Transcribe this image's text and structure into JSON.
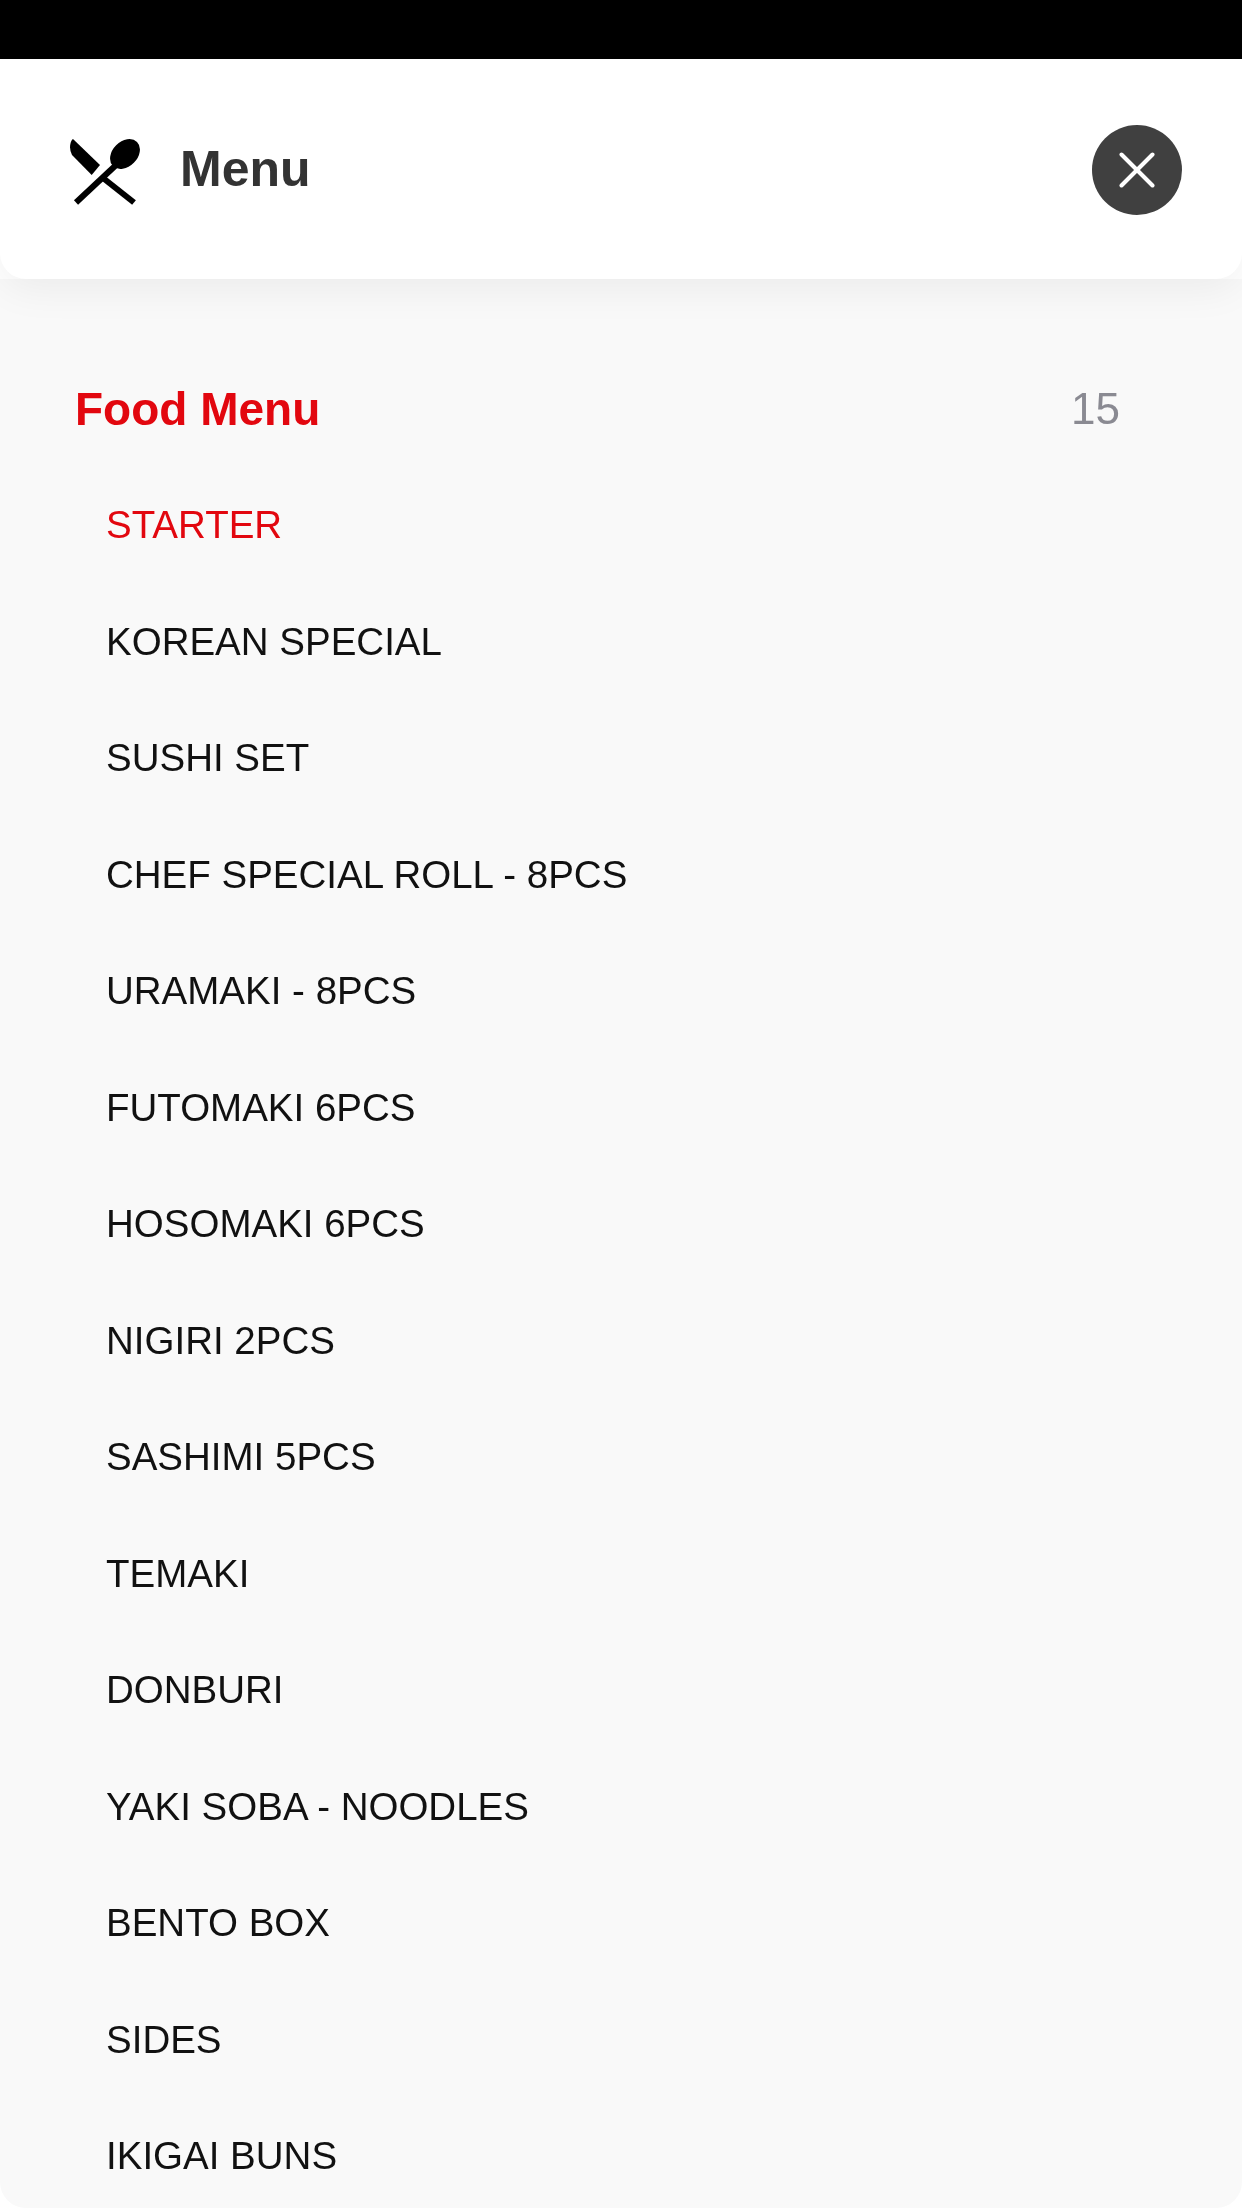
{
  "header": {
    "title": "Menu"
  },
  "section": {
    "title": "Food Menu",
    "count": "15"
  },
  "items": [
    {
      "label": "STARTER",
      "selected": true
    },
    {
      "label": "KOREAN SPECIAL",
      "selected": false
    },
    {
      "label": "SUSHI SET",
      "selected": false
    },
    {
      "label": "CHEF SPECIAL ROLL - 8PCS",
      "selected": false
    },
    {
      "label": "URAMAKI - 8PCS",
      "selected": false
    },
    {
      "label": "FUTOMAKI 6PCS",
      "selected": false
    },
    {
      "label": "HOSOMAKI 6PCS",
      "selected": false
    },
    {
      "label": "NIGIRI 2PCS",
      "selected": false
    },
    {
      "label": "SASHIMI 5PCS",
      "selected": false
    },
    {
      "label": "TEMAKI",
      "selected": false
    },
    {
      "label": "DONBURI",
      "selected": false
    },
    {
      "label": "YAKI SOBA - NOODLES",
      "selected": false
    },
    {
      "label": "BENTO BOX",
      "selected": false
    },
    {
      "label": "SIDES",
      "selected": false
    },
    {
      "label": "IKIGAI BUNS",
      "selected": false
    }
  ]
}
